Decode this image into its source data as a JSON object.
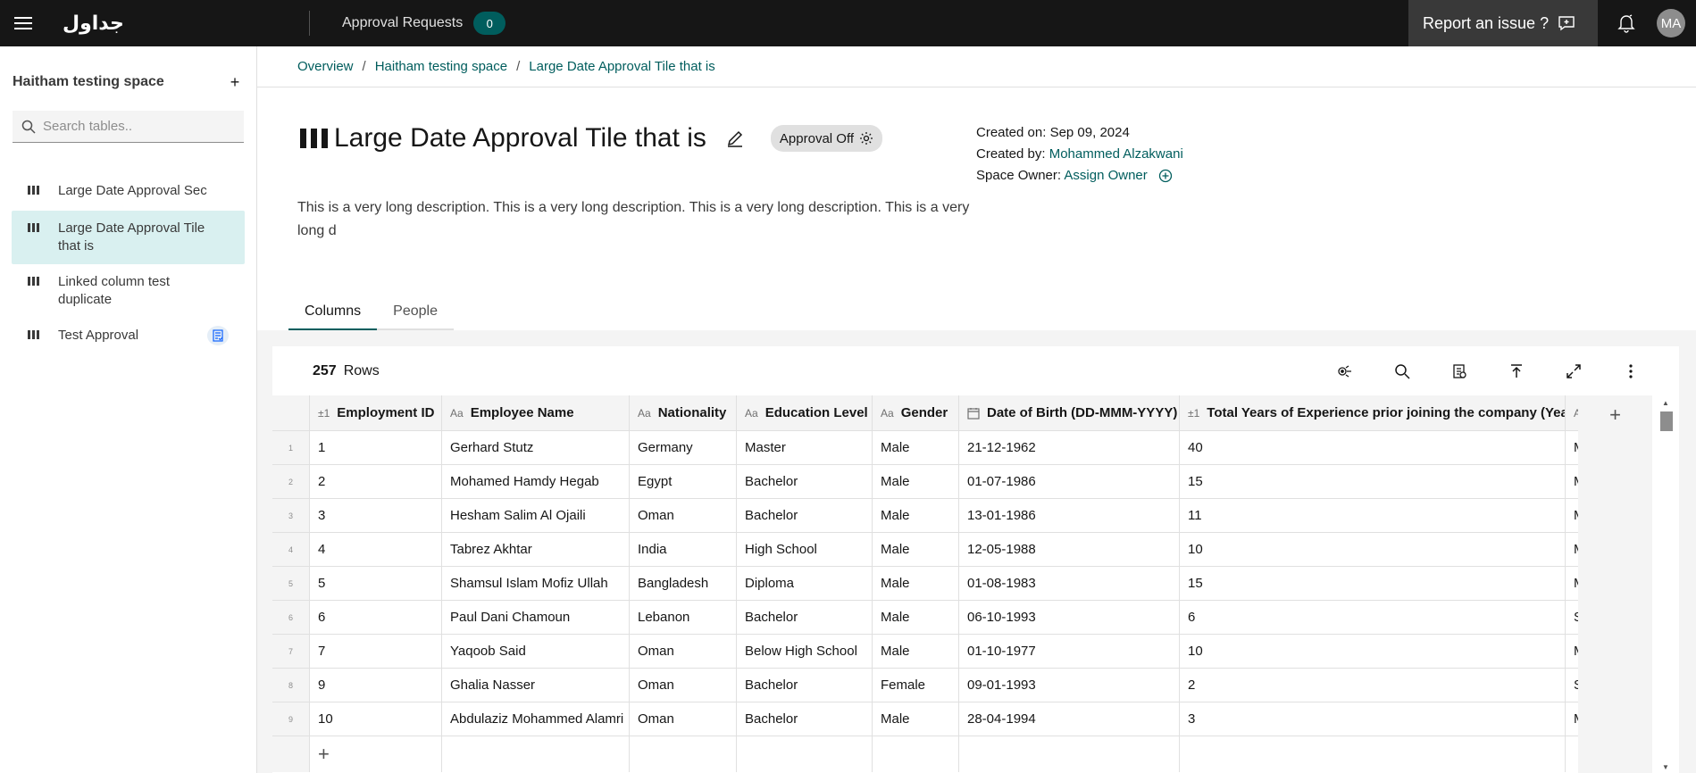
{
  "topbar": {
    "logo": "جداول",
    "approval_label": "Approval Requests",
    "approval_count": "0",
    "report_label": "Report an issue ?",
    "avatar_initials": "MA"
  },
  "sidebar": {
    "space_title": "Haitham testing space",
    "add_label": "+",
    "search_placeholder": "Search tables..",
    "items": [
      {
        "label": "Large Date Approval Sec"
      },
      {
        "label": "Large Date Approval Tile that is"
      },
      {
        "label": "Linked column test duplicate"
      },
      {
        "label": "Test Approval"
      }
    ]
  },
  "breadcrumb": {
    "items": [
      "Overview",
      "Haitham testing space",
      "Large Date Approval Tile that is"
    ],
    "separator": "/"
  },
  "page": {
    "title": "Large Date Approval Tile that is",
    "approval_status": "Approval Off",
    "description": "This is a very long description. This is a very long description. This is a very long description. This is a very long d",
    "created_on_label": "Created on:",
    "created_on_value": "Sep 09, 2024",
    "created_by_label": "Created by:",
    "created_by_value": "Mohammed Alzakwani",
    "space_owner_label": "Space Owner:",
    "space_owner_value": "Assign Owner"
  },
  "tabs": [
    {
      "label": "Columns",
      "active": true
    },
    {
      "label": "People",
      "active": false
    }
  ],
  "table": {
    "row_count": "257",
    "rows_label": "Rows",
    "columns": [
      {
        "type": "±1",
        "name": "Employment ID"
      },
      {
        "type": "Aa",
        "name": "Employee Name"
      },
      {
        "type": "Aa",
        "name": "Nationality"
      },
      {
        "type": "Aa",
        "name": "Education Level"
      },
      {
        "type": "Aa",
        "name": "Gender"
      },
      {
        "type": "date",
        "name": "Date of Birth (DD-MMM-YYYY)"
      },
      {
        "type": "±1",
        "name": "Total Years of Experience prior joining the company (Years)"
      },
      {
        "type": "A",
        "name": ""
      }
    ],
    "rows": [
      {
        "idx": "1",
        "cells": [
          "1",
          "Gerhard Stutz",
          "Germany",
          "Master",
          "Male",
          "21-12-1962",
          "40",
          "M"
        ]
      },
      {
        "idx": "2",
        "cells": [
          "2",
          "Mohamed Hamdy Hegab",
          "Egypt",
          "Bachelor",
          "Male",
          "01-07-1986",
          "15",
          "M"
        ]
      },
      {
        "idx": "3",
        "cells": [
          "3",
          "Hesham Salim Al Ojaili",
          "Oman",
          "Bachelor",
          "Male",
          "13-01-1986",
          "11",
          "M"
        ]
      },
      {
        "idx": "4",
        "cells": [
          "4",
          "Tabrez Akhtar",
          "India",
          "High School",
          "Male",
          "12-05-1988",
          "10",
          "M"
        ]
      },
      {
        "idx": "5",
        "cells": [
          "5",
          "Shamsul Islam Mofiz Ullah",
          "Bangladesh",
          "Diploma",
          "Male",
          "01-08-1983",
          "15",
          "M"
        ]
      },
      {
        "idx": "6",
        "cells": [
          "6",
          "Paul Dani Chamoun",
          "Lebanon",
          "Bachelor",
          "Male",
          "06-10-1993",
          "6",
          "S"
        ]
      },
      {
        "idx": "7",
        "cells": [
          "7",
          "Yaqoob  Said",
          "Oman",
          "Below High School",
          "Male",
          "01-10-1977",
          "10",
          "M"
        ]
      },
      {
        "idx": "8",
        "cells": [
          "9",
          "Ghalia Nasser",
          "Oman",
          "Bachelor",
          "Female",
          "09-01-1993",
          "2",
          "S"
        ]
      },
      {
        "idx": "9",
        "cells": [
          "10",
          "Abdulaziz Mohammed Alamri",
          "Oman",
          "Bachelor",
          "Male",
          "28-04-1994",
          "3",
          "M"
        ]
      }
    ],
    "add_row_label": "+",
    "add_column_label": "+"
  },
  "colors": {
    "topbar": "#161616",
    "accent": "#005d5d",
    "selected": "#d9f0f0"
  }
}
